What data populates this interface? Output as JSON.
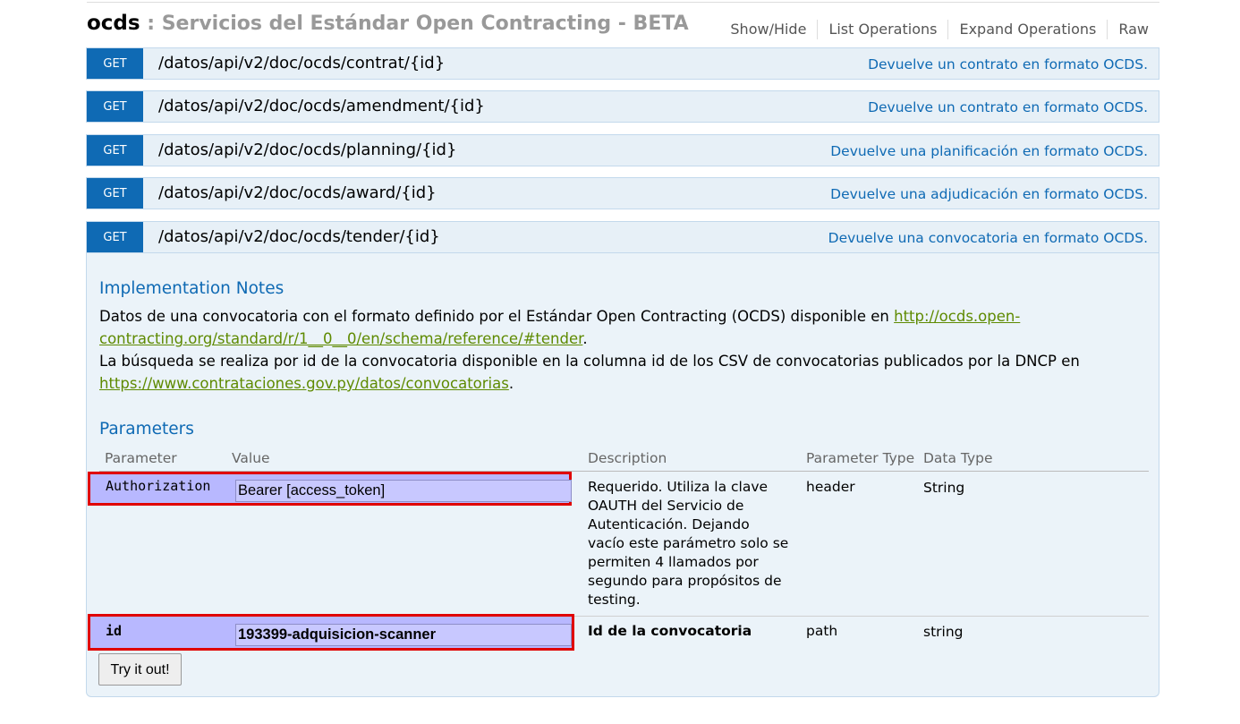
{
  "header": {
    "api_name": "ocds",
    "api_description": " : Servicios del Estándar Open Contracting - BETA",
    "ops": [
      "Show/Hide",
      "List Operations",
      "Expand Operations",
      "Raw"
    ]
  },
  "operations": [
    {
      "verb": "GET",
      "path": "/datos/api/v2/doc/ocds/contrat/{id}",
      "summary": "Devuelve un contrato en formato OCDS."
    },
    {
      "verb": "GET",
      "path": "/datos/api/v2/doc/ocds/amendment/{id}",
      "summary": "Devuelve un contrato en formato OCDS."
    },
    {
      "verb": "GET",
      "path": "/datos/api/v2/doc/ocds/planning/{id}",
      "summary": "Devuelve una planificación en formato OCDS."
    },
    {
      "verb": "GET",
      "path": "/datos/api/v2/doc/ocds/award/{id}",
      "summary": "Devuelve una adjudicación en formato OCDS."
    },
    {
      "verb": "GET",
      "path": "/datos/api/v2/doc/ocds/tender/{id}",
      "summary": "Devuelve una convocatoria en formato OCDS."
    }
  ],
  "details": {
    "implementation_heading": "Implementation Notes",
    "notes": {
      "line1_text": "Datos de una convocatoria con el formato definido por el Estándar Open Contracting (OCDS) disponible en ",
      "line1_link": "http://ocds.open-contracting.org/standard/r/1__0__0/en/schema/reference/#tender",
      "line1_end": ".",
      "line2_text": "La búsqueda se realiza por id de la convocatoria disponible en la columna id de los CSV de convocatorias publicados por la DNCP en ",
      "line2_link": "https://www.contrataciones.gov.py/datos/convocatorias",
      "line2_end": "."
    },
    "parameters_heading": "Parameters",
    "columns": [
      "Parameter",
      "Value",
      "Description",
      "Parameter Type",
      "Data Type"
    ],
    "params": [
      {
        "name": "Authorization",
        "value": "Bearer [access_token]",
        "description": "Requerido. Utiliza la clave OAUTH del Servicio de Autenticación. Dejando vacío este parámetro solo se permiten 4 llamados por segundo para propósitos de testing.",
        "param_type": "header",
        "data_type": "String"
      },
      {
        "name": "id",
        "value": "193399-adquisicion-scanner",
        "description": "Id de la convocatoria",
        "param_type": "path",
        "data_type": "string"
      }
    ],
    "try_button": "Try it out!"
  },
  "colors": {
    "verb_get": "#0f6ab4",
    "highlight_border": "#e00000",
    "link": "#5e8a00"
  }
}
